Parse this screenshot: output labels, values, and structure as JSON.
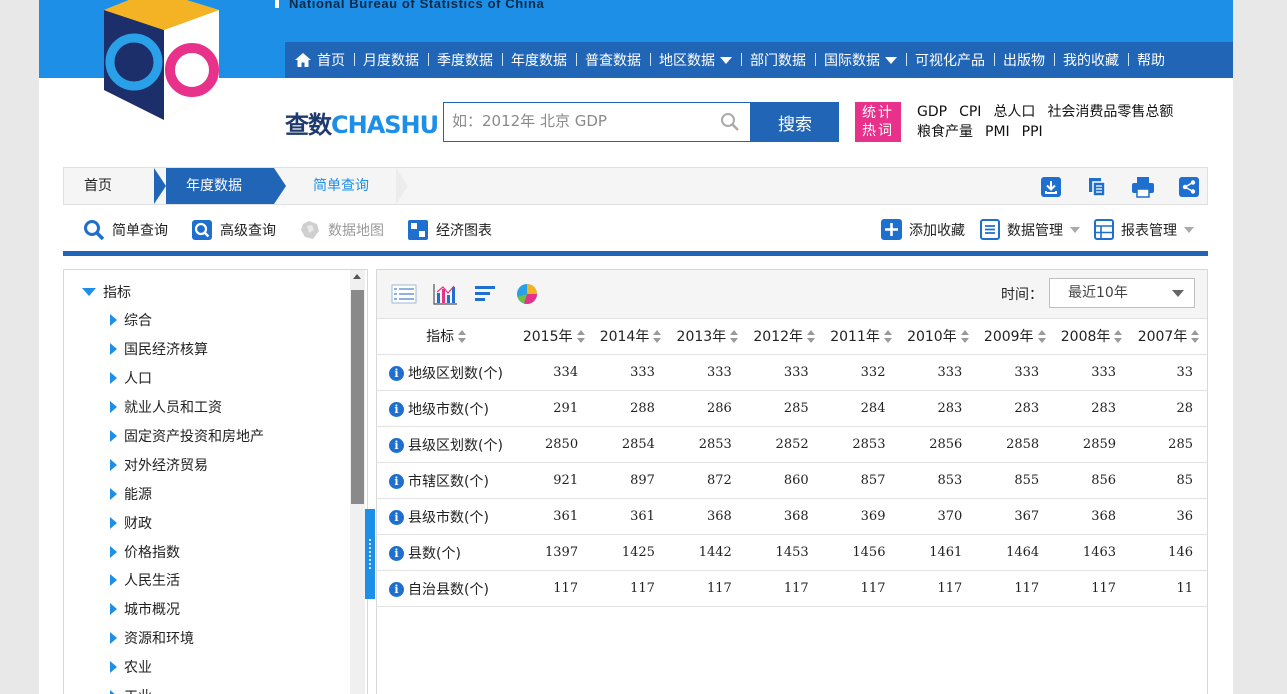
{
  "header": {
    "bureau_name": "National Bureau of Statistics of China",
    "nav": [
      {
        "label": "首页",
        "home": true
      },
      {
        "label": "月度数据"
      },
      {
        "label": "季度数据"
      },
      {
        "label": "年度数据"
      },
      {
        "label": "普查数据"
      },
      {
        "label": "地区数据",
        "dropdown": true
      },
      {
        "label": "部门数据"
      },
      {
        "label": "国际数据",
        "dropdown": true
      },
      {
        "label": "可视化产品"
      },
      {
        "label": "出版物"
      },
      {
        "label": "我的收藏"
      },
      {
        "label": "帮助"
      }
    ]
  },
  "search": {
    "logo_cha": "查数",
    "logo_shu": "CHASHU",
    "placeholder": "如：2012年 北京 GDP",
    "button": "搜索",
    "hot_badge": "统计 热词",
    "hot_terms_row1": [
      "GDP",
      "CPI",
      "总人口",
      "社会消费品零售总额"
    ],
    "hot_terms_row2": [
      "粮食产量",
      "PMI",
      "PPI"
    ]
  },
  "breadcrumb": {
    "home": "首页",
    "year": "年度数据",
    "current": "简单查询"
  },
  "modes": {
    "simple": "简单查询",
    "advanced": "高级查询",
    "map": "数据地图",
    "chart": "经济图表",
    "add_fav": "添加收藏",
    "data_mgmt": "数据管理",
    "report_mgmt": "报表管理"
  },
  "tree": {
    "root": "指标",
    "items": [
      "综合",
      "国民经济核算",
      "人口",
      "就业人员和工资",
      "固定资产投资和房地产",
      "对外经济贸易",
      "能源",
      "财政",
      "价格指数",
      "人民生活",
      "城市概况",
      "资源和环境",
      "农业",
      "工业"
    ]
  },
  "table": {
    "time_label": "时间：",
    "time_value": "最近10年",
    "indicator_header": "指标",
    "years": [
      "2015年",
      "2014年",
      "2013年",
      "2012年",
      "2011年",
      "2010年",
      "2009年",
      "2008年",
      "2007年"
    ],
    "rows": [
      {
        "name": "地级区划数(个)",
        "values": [
          "334",
          "333",
          "333",
          "333",
          "332",
          "333",
          "333",
          "333",
          "33"
        ]
      },
      {
        "name": "地级市数(个)",
        "values": [
          "291",
          "288",
          "286",
          "285",
          "284",
          "283",
          "283",
          "283",
          "28"
        ]
      },
      {
        "name": "县级区划数(个)",
        "values": [
          "2850",
          "2854",
          "2853",
          "2852",
          "2853",
          "2856",
          "2858",
          "2859",
          "285"
        ]
      },
      {
        "name": "市辖区数(个)",
        "values": [
          "921",
          "897",
          "872",
          "860",
          "857",
          "853",
          "855",
          "856",
          "85"
        ]
      },
      {
        "name": "县级市数(个)",
        "values": [
          "361",
          "361",
          "368",
          "368",
          "369",
          "370",
          "367",
          "368",
          "36"
        ]
      },
      {
        "name": "县数(个)",
        "values": [
          "1397",
          "1425",
          "1442",
          "1453",
          "1456",
          "1461",
          "1464",
          "1463",
          "146"
        ]
      },
      {
        "name": "自治县数(个)",
        "values": [
          "117",
          "117",
          "117",
          "117",
          "117",
          "117",
          "117",
          "117",
          "11"
        ]
      }
    ]
  },
  "colors": {
    "banner": "#1e8fe6",
    "nav": "#2065b6",
    "hot_badge": "#e8318a",
    "info_icon": "#1e6fd0"
  }
}
